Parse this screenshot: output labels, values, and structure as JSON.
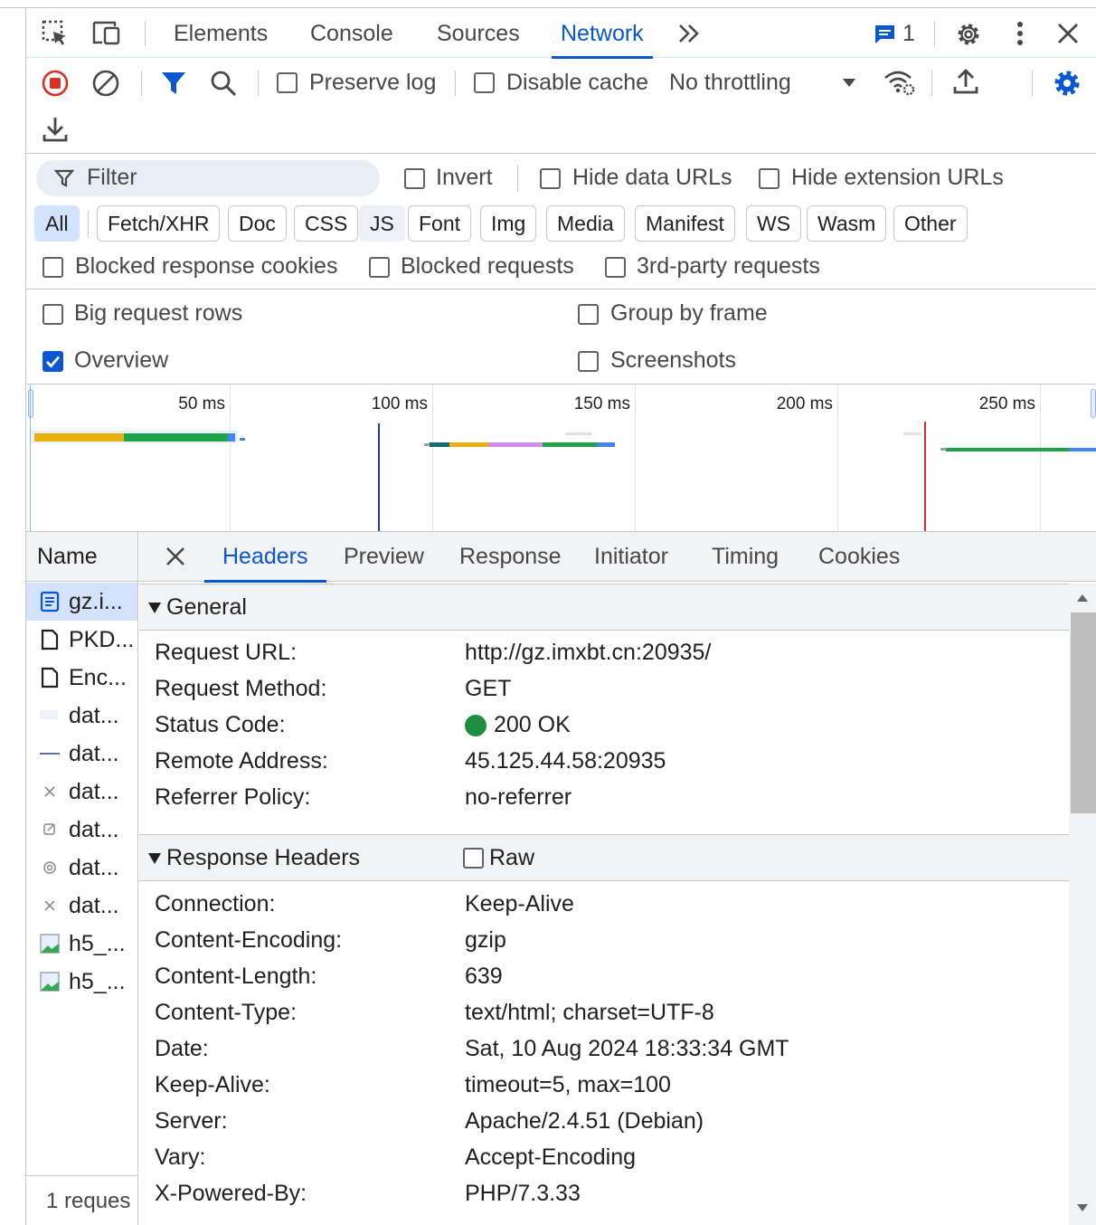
{
  "main_tabs": [
    "Elements",
    "Console",
    "Sources",
    "Network"
  ],
  "issues_count": "1",
  "toolbar": {
    "preserve_log": "Preserve log",
    "disable_cache": "Disable cache",
    "throttling": "No throttling"
  },
  "filter": {
    "placeholder": "Filter",
    "invert": "Invert",
    "hide_data_urls": "Hide data URLs",
    "hide_extension_urls": "Hide extension URLs",
    "types": [
      "All",
      "Fetch/XHR",
      "Doc",
      "CSS",
      "JS",
      "Font",
      "Img",
      "Media",
      "Manifest",
      "WS",
      "Wasm",
      "Other"
    ],
    "blocked_response_cookies": "Blocked response cookies",
    "blocked_requests": "Blocked requests",
    "third_party": "3rd-party requests"
  },
  "settings": {
    "big_rows": "Big request rows",
    "group_by_frame": "Group by frame",
    "overview": "Overview",
    "screenshots": "Screenshots",
    "overview_checked": true
  },
  "overview_ticks": [
    "50 ms",
    "100 ms",
    "150 ms",
    "200 ms",
    "250 ms"
  ],
  "name_column": {
    "header": "Name",
    "rows": [
      "gz.i...",
      "PKD...",
      "Enc...",
      "dat...",
      "dat...",
      "dat...",
      "dat...",
      "dat...",
      "dat...",
      "h5_...",
      "h5_..."
    ],
    "footer": "1 reques"
  },
  "detail_tabs": [
    "Headers",
    "Preview",
    "Response",
    "Initiator",
    "Timing",
    "Cookies"
  ],
  "general": {
    "title": "General",
    "rows": [
      {
        "k": "Request URL:",
        "v": "http://gz.imxbt.cn:20935/"
      },
      {
        "k": "Request Method:",
        "v": "GET"
      },
      {
        "k": "Status Code:",
        "v": "200 OK"
      },
      {
        "k": "Remote Address:",
        "v": "45.125.44.58:20935"
      },
      {
        "k": "Referrer Policy:",
        "v": "no-referrer"
      }
    ]
  },
  "response_headers": {
    "title": "Response Headers",
    "raw": "Raw",
    "rows": [
      {
        "k": "Connection:",
        "v": "Keep-Alive"
      },
      {
        "k": "Content-Encoding:",
        "v": "gzip"
      },
      {
        "k": "Content-Length:",
        "v": "639"
      },
      {
        "k": "Content-Type:",
        "v": "text/html; charset=UTF-8"
      },
      {
        "k": "Date:",
        "v": "Sat, 10 Aug 2024 18:33:34 GMT"
      },
      {
        "k": "Keep-Alive:",
        "v": "timeout=5, max=100"
      },
      {
        "k": "Server:",
        "v": "Apache/2.4.51 (Debian)"
      },
      {
        "k": "Vary:",
        "v": "Accept-Encoding"
      },
      {
        "k": "X-Powered-By:",
        "v": "PHP/7.3.33"
      }
    ]
  },
  "colors": {
    "accent": "#0b57d0",
    "status_ok": "#1e8e3e",
    "record": "#d93025"
  }
}
